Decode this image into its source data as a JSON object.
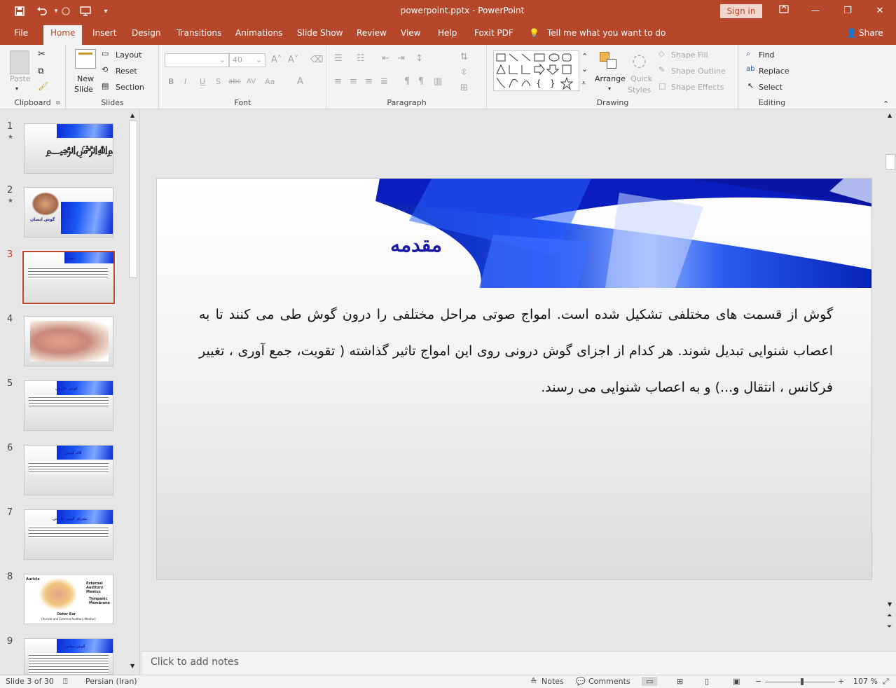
{
  "titlebar": {
    "document_title": "powerpoint.pptx  -  PowerPoint",
    "signin_label": "Sign in",
    "bg_color": "#b7472a"
  },
  "tabs": [
    "File",
    "Home",
    "Insert",
    "Design",
    "Transitions",
    "Animations",
    "Slide Show",
    "Review",
    "View",
    "Help",
    "Foxit PDF"
  ],
  "tell_me": "Tell me what you want to do",
  "share": "Share",
  "ribbon": {
    "clipboard": {
      "paste": "Paste",
      "label": "Clipboard"
    },
    "slides": {
      "new_slide_1": "New",
      "new_slide_2": "Slide",
      "layout": "Layout",
      "reset": "Reset",
      "section": "Section",
      "label": "Slides"
    },
    "font": {
      "size": "40",
      "label": "Font"
    },
    "paragraph": {
      "label": "Paragraph"
    },
    "drawing": {
      "arrange": "Arrange",
      "quick_1": "Quick",
      "quick_2": "Styles",
      "shape_fill": "Shape Fill",
      "shape_outline": "Shape Outline",
      "shape_effects": "Shape Effects",
      "label": "Drawing"
    },
    "editing": {
      "find": "Find",
      "replace": "Replace",
      "select": "Select",
      "label": "Editing"
    }
  },
  "thumbnails": [
    {
      "num": "1",
      "star": "★"
    },
    {
      "num": "2",
      "star": "★",
      "caption": "گوش انسان"
    },
    {
      "num": "3",
      "star": "",
      "caption": "مقدمه"
    },
    {
      "num": "4",
      "star": ""
    },
    {
      "num": "5",
      "star": "",
      "caption": "گوش خارجی"
    },
    {
      "num": "6",
      "star": "",
      "caption": "لاله گوش"
    },
    {
      "num": "7",
      "star": "",
      "caption": "مجرای گوش خارجی"
    },
    {
      "num": "8",
      "star": "",
      "labels": [
        "Auricle",
        "External Auditory Meatus",
        "Tympanic Membrane",
        "Outer Ear",
        "(Auricle and External Auditory Meatus)"
      ]
    },
    {
      "num": "9",
      "star": "",
      "caption": "گوش میانی"
    }
  ],
  "slide": {
    "title": "مقدمه",
    "body": "گوش از قسمت های مختلفی تشکیل شده است. امواج صوتی مراحل مختلفی را درون گوش طی می کنند تا به اعصاب شنوایی تبدیل شوند. هر کدام از اجزای گوش درونی روی این امواج تاثیر گذاشته ( تقویت، جمع آوری ، تغییر فرکانس ، انتقال و...) و به اعصاب شنوایی می رسند."
  },
  "notes_placeholder": "Click to add notes",
  "status": {
    "slide_indicator": "Slide 3 of 30",
    "language": "Persian (Iran)",
    "notes": "Notes",
    "comments": "Comments",
    "zoom": "107 %",
    "zoom_level": 1.07
  },
  "colors": {
    "accent": "#b7472a",
    "slide_title": "#1a1aa6",
    "band": "#0a2bd8"
  }
}
